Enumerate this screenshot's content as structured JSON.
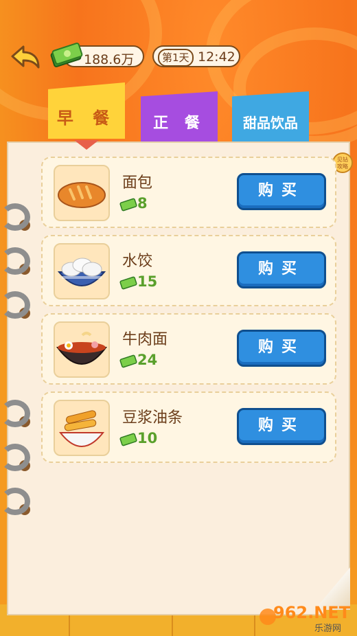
{
  "top_bar": {
    "back_icon": "back-arrow-icon",
    "money": "188.6万",
    "day": "第1天",
    "time": "12:42"
  },
  "tabs": [
    {
      "label": "早 餐",
      "color": "#ffd33a",
      "active": true
    },
    {
      "label": "正 餐",
      "color": "#a64de0",
      "active": false
    },
    {
      "label": "甜品饮品",
      "color": "#3fa8e2",
      "active": false
    }
  ],
  "badge": "见钻\n攻略",
  "items": [
    {
      "name": "面包",
      "price": "8",
      "buy_label": "购买",
      "icon": "bread-icon"
    },
    {
      "name": "水饺",
      "price": "15",
      "buy_label": "购买",
      "icon": "dumplings-icon"
    },
    {
      "name": "牛肉面",
      "price": "24",
      "buy_label": "购买",
      "icon": "beef-noodles-icon"
    },
    {
      "name": "豆浆油条",
      "price": "10",
      "buy_label": "购买",
      "icon": "fried-dough-icon"
    }
  ],
  "watermark": {
    "main": "962.NET",
    "sub": "乐游网"
  }
}
